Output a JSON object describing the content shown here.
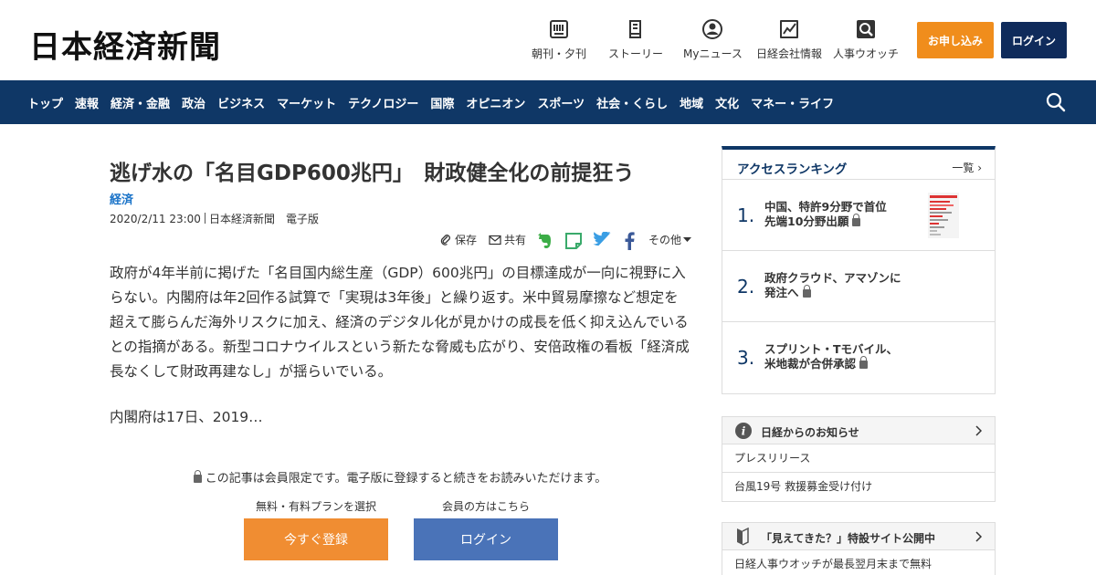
{
  "header": {
    "logo": "日本経済新聞",
    "nav": [
      {
        "label": "朝刊・夕刊",
        "icon": "newspaper-icon"
      },
      {
        "label": "ストーリー",
        "icon": "book-icon"
      },
      {
        "label": "Myニュース",
        "icon": "user-icon"
      },
      {
        "label": "日経会社情報",
        "icon": "chart-icon"
      },
      {
        "label": "人事ウオッチ",
        "icon": "search-box-icon"
      }
    ],
    "apply_label": "お申し込み",
    "login_label": "ログイン"
  },
  "navbar": {
    "items": [
      "トップ",
      "速報",
      "経済・金融",
      "政治",
      "ビジネス",
      "マーケット",
      "テクノロジー",
      "国際",
      "オピニオン",
      "スポーツ",
      "社会・くらし",
      "地域",
      "文化",
      "マネー・ライフ"
    ]
  },
  "article": {
    "headline": "逃げ水の「名目GDP600兆円」　財政健全化の前提狂う",
    "category": "経済",
    "date": "2020/2/11 23:00",
    "source": "日本経済新聞　電子版",
    "share": {
      "save": "保存",
      "share": "共有",
      "more": "その他"
    },
    "body": "政府が4年半前に掲げた「名目国内総生産（GDP）600兆円」の目標達成が一向に視野に入らない。内閣府は年2回作る試算で「実現は3年後」と繰り返す。米中貿易摩擦など想定を超えて膨らんだ海外リスクに加え、経済のデジタル化が見かけの成長を低く抑え込んでいるとの指摘がある。新型コロナウイルスという新たな脅威も広がり、安倍政権の看板「経済成長なくして財政再建なし」が揺らいでいる。",
    "continued": "内閣府は17日、2019…",
    "members_note": "この記事は会員限定です。電子版に登録すると続きをお読みいただけます。",
    "plan_label": "無料・有料プランを選択",
    "member_label": "会員の方はこちら",
    "register_button": "今すぐ登録",
    "login_button": "ログイン"
  },
  "sidebar": {
    "ranking": {
      "title": "アクセスランキング",
      "all": "一覧",
      "items": [
        {
          "rank": "1.",
          "line1": "中国、特許9分野で首位",
          "line2": "先端10分野出願"
        },
        {
          "rank": "2.",
          "line1": "政府クラウド、アマゾンに",
          "line2": "発注へ"
        },
        {
          "rank": "3.",
          "line1": "スプリント・Tモバイル、",
          "line2": "米地裁が合併承認"
        }
      ]
    },
    "notice": {
      "title": "日経からのお知らせ",
      "rows": [
        "プレスリリース",
        "台風19号 救援募金受け付け"
      ]
    },
    "special": {
      "title": "「見えてきた？」特設サイト公開中",
      "rows": [
        "日経人事ウオッチが最長翌月末まで無料"
      ]
    }
  },
  "colors": {
    "navy": "#0f3766",
    "orange": "#f08d1c",
    "blue_button": "#4a73b8",
    "link_blue": "#1a73c8"
  }
}
